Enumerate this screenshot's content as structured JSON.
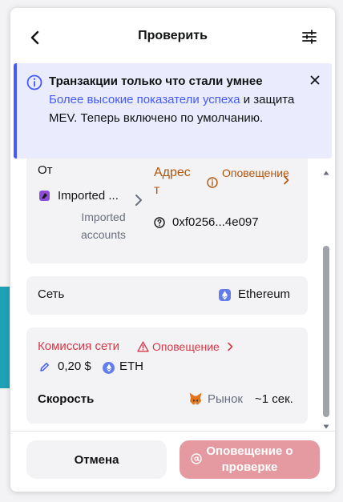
{
  "header": {
    "title": "Проверить"
  },
  "banner": {
    "title": "Транзакции только что стали умнее",
    "link_text": "Более высокие показатели успеха",
    "rest_text": " и защита MEV. Теперь включено по умолчанию."
  },
  "from": {
    "label": "От",
    "account_name": "Imported ...",
    "account_group": "Imported accounts"
  },
  "to": {
    "label": "Адрес",
    "label_tail": "т",
    "alert_label": "Оповещение",
    "address": "0xf0256...4e097"
  },
  "network": {
    "label": "Сеть",
    "value": "Ethereum"
  },
  "fee": {
    "label": "Комиссия сети",
    "alert_label": "Оповещение",
    "amount": "0,20 $",
    "currency": "ETH",
    "speed_label": "Скорость",
    "speed_mode": "Рынок",
    "speed_time": "~1 сек."
  },
  "footer": {
    "cancel_label": "Отмена",
    "alert_button_label": "Оповещение о проверке"
  },
  "colors": {
    "accent": "#4459ff",
    "warning": "#b45309",
    "danger": "#d73847",
    "danger_muted": "#e59aa1"
  }
}
